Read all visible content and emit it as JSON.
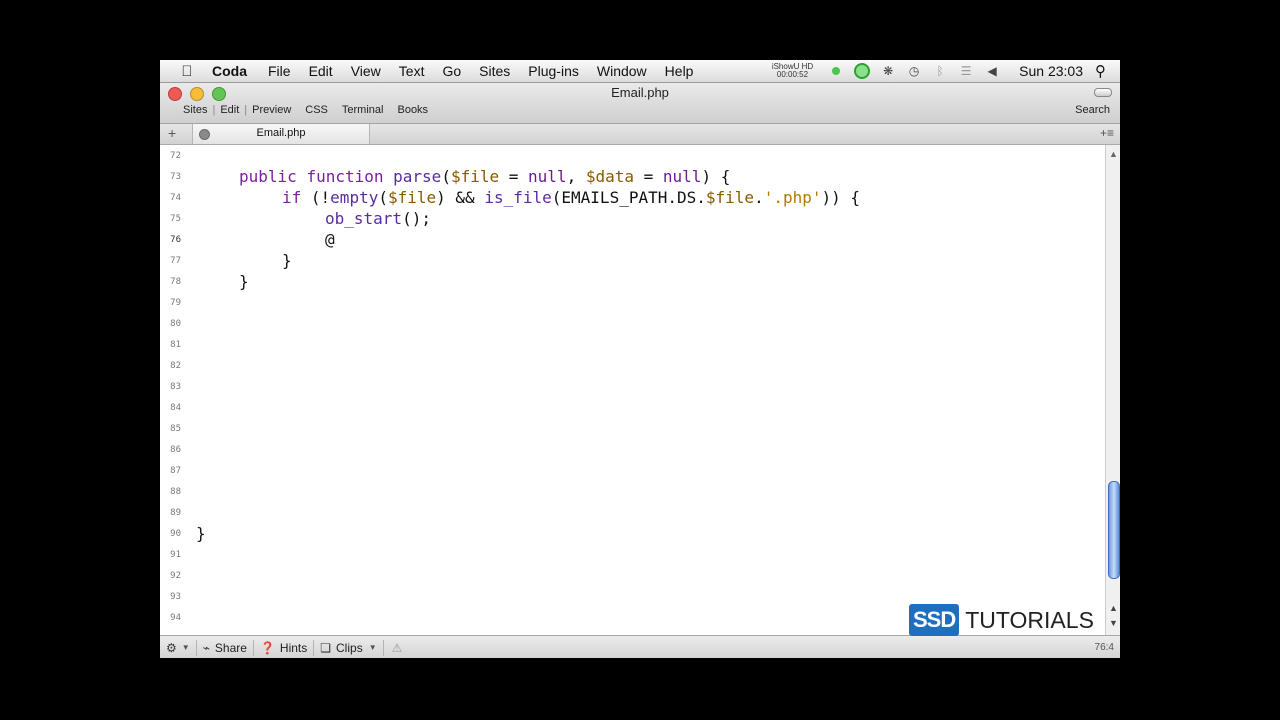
{
  "menubar": {
    "apple_icon": "apple-icon",
    "app_name": "Coda",
    "items": [
      "File",
      "Edit",
      "View",
      "Text",
      "Go",
      "Sites",
      "Plug-ins",
      "Window",
      "Help"
    ],
    "ishowu_line1": "iShowU HD",
    "ishowu_line2": "00:00:52",
    "clock": "Sun 23:03"
  },
  "window": {
    "title": "Email.php",
    "modes": [
      "Sites",
      "Edit",
      "Preview",
      "CSS",
      "Terminal",
      "Books"
    ],
    "search_label": "Search"
  },
  "tab": {
    "label": "Email.php"
  },
  "editor": {
    "line_numbers": [
      "72",
      "73",
      "74",
      "75",
      "76",
      "77",
      "78",
      "79",
      "80",
      "81",
      "82",
      "83",
      "84",
      "85",
      "86",
      "87",
      "88",
      "89",
      "90",
      "91",
      "92",
      "93",
      "94"
    ],
    "current_line": "76",
    "lines": {
      "l73_kw1": "public",
      "l73_kw2": "function",
      "l73_fn": "parse",
      "l73_p1": "(",
      "l73_v1": "$file",
      "l73_p2": " = ",
      "l73_n1": "null",
      "l73_p3": ", ",
      "l73_v2": "$data",
      "l73_p4": " = ",
      "l73_n2": "null",
      "l73_p5": ") {",
      "l74_kw": "if",
      "l74_p1": " (!",
      "l74_fn1": "empty",
      "l74_p2": "(",
      "l74_v1": "$file",
      "l74_p3": ") && ",
      "l74_fn2": "is_file",
      "l74_p4": "(EMAILS_PATH.DS.",
      "l74_v2": "$file",
      "l74_p5": ".",
      "l74_str": "'.php'",
      "l74_p6": ")) {",
      "l75_fn": "ob_start",
      "l75_p": "();",
      "l76": "@",
      "l77": "}",
      "l78": "}",
      "l90": "}"
    }
  },
  "statusbar": {
    "share": "Share",
    "hints": "Hints",
    "clips": "Clips",
    "position": "76:4"
  },
  "logo": {
    "badge": "SSD",
    "text": "TUTORIALS"
  }
}
